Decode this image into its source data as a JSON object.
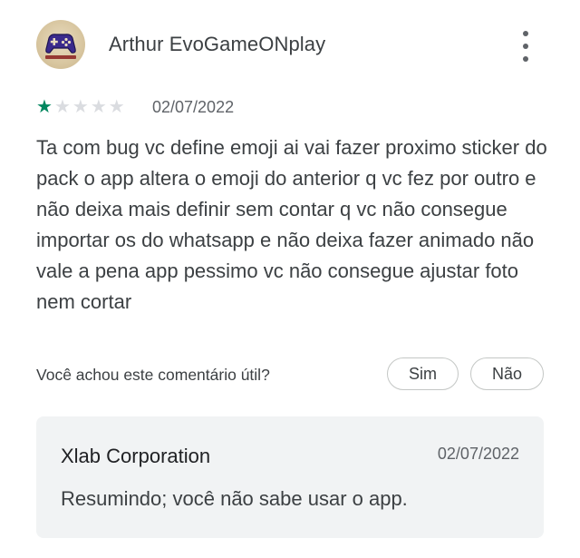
{
  "review": {
    "author": "Arthur EvoGameONplay",
    "avatar_icon": "gamepad-icon",
    "avatar_caption": "EvoGameONplay",
    "rating": 1,
    "rating_max": 5,
    "date": "02/07/2022",
    "text": "Ta com bug vc define emoji ai vai fazer proximo sticker do pack o app altera o emoji do anterior q vc fez por outro e não deixa mais definir sem contar q vc não consegue importar os do whatsapp e não deixa fazer animado não vale a pena app pessimo vc não consegue ajustar foto nem cortar",
    "more_icon": "more-vert-icon"
  },
  "helpful": {
    "question": "Você achou este comentário útil?",
    "yes_label": "Sim",
    "no_label": "Não"
  },
  "developer_reply": {
    "name": "Xlab Corporation",
    "date": "02/07/2022",
    "text": "Resumindo; você não sabe usar o app."
  },
  "colors": {
    "star_filled": "#01875f",
    "star_empty": "#dadce0",
    "reply_background": "#f1f3f4"
  }
}
